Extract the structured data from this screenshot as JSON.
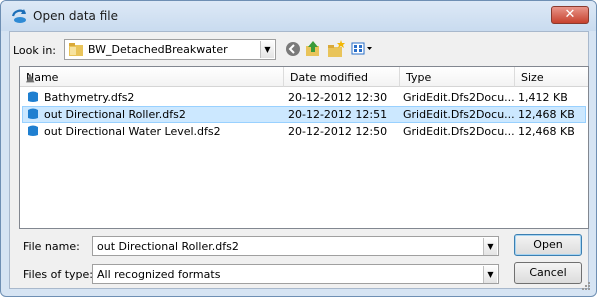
{
  "window": {
    "title": "Open data file",
    "close_label": "✕"
  },
  "lookin": {
    "label": "Look in:",
    "value": "BW_DetachedBreakwater"
  },
  "toolbar": {
    "icons": [
      "back-icon",
      "up-folder-icon",
      "new-folder-icon",
      "view-menu-icon"
    ]
  },
  "columns": {
    "name": "Name",
    "date": "Date modified",
    "type": "Type",
    "size": "Size"
  },
  "files": [
    {
      "name": "Bathymetry.dfs2",
      "date": "20-12-2012 12:30",
      "type": "GridEdit.Dfs2Docu...",
      "size": "1,412 KB"
    },
    {
      "name": "out Directional Roller.dfs2",
      "date": "20-12-2012 12:51",
      "type": "GridEdit.Dfs2Docu...",
      "size": "12,468 KB"
    },
    {
      "name": "out Directional Water Level.dfs2",
      "date": "20-12-2012 12:50",
      "type": "GridEdit.Dfs2Docu...",
      "size": "12,468 KB"
    }
  ],
  "selected_index": 1,
  "filename": {
    "label": "File name:",
    "value": "out Directional Roller.dfs2"
  },
  "filetype": {
    "label": "Files of type:",
    "value": "All recognized formats"
  },
  "buttons": {
    "open": "Open",
    "cancel": "Cancel"
  },
  "colors": {
    "selection": "#cce8ff",
    "file_icon": "#1f7fd0",
    "close_button": "#c7412e"
  }
}
